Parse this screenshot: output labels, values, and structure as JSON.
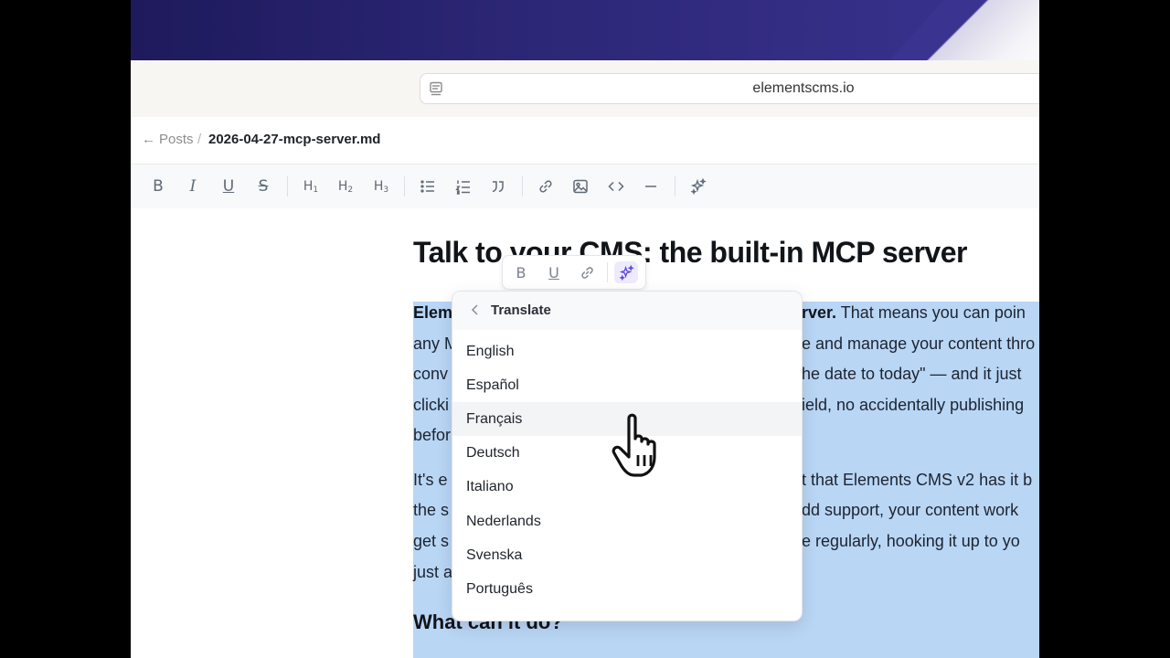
{
  "browser": {
    "url": "elementscms.io"
  },
  "breadcrumb": {
    "back_label": "Posts",
    "separator": "/",
    "file_name": "2026-04-27-mcp-server.md"
  },
  "toolbar": {
    "bold": "B",
    "italic": "I",
    "underline": "U",
    "strike": "S",
    "h1": "H",
    "h1_sub": "1",
    "h2": "H",
    "h2_sub": "2",
    "h3": "H",
    "h3_sub": "3"
  },
  "document": {
    "title": "Talk to your CMS: the built-in MCP server",
    "lines": [
      {
        "bold": "Elem",
        "gap": "",
        "bold2": "rver.",
        "text": " That means you can poin"
      },
      {
        "text_left": "any M",
        "text_right": "e and manage your content thro"
      },
      {
        "text_left": "conv",
        "text_right": "he date to today\" — and it just"
      },
      {
        "text_left": "clicki",
        "text_right": "ield, no accidentally publishing"
      },
      {
        "text_left": "befor",
        "text_right": ""
      },
      {
        "text_left": "It's e",
        "text_right": "t that Elements CMS v2 has it b"
      },
      {
        "text_left": "the s",
        "text_right": "dd support, your content work"
      },
      {
        "text_left": "get s",
        "text_right": "e regularly, hooking it up to yo"
      },
      {
        "text_left": "just a",
        "text_right": ""
      }
    ],
    "heading2": "What can it do?"
  },
  "bubble": {
    "bold": "B",
    "underline": "U"
  },
  "translate_menu": {
    "title": "Translate",
    "languages": [
      "English",
      "Español",
      "Français",
      "Deutsch",
      "Italiano",
      "Nederlands",
      "Svenska",
      "Português"
    ],
    "hovered": "Français"
  },
  "colors": {
    "selection": "#b9d6f5",
    "accent": "#5b48d6",
    "wallpaper": "#2d2777"
  }
}
